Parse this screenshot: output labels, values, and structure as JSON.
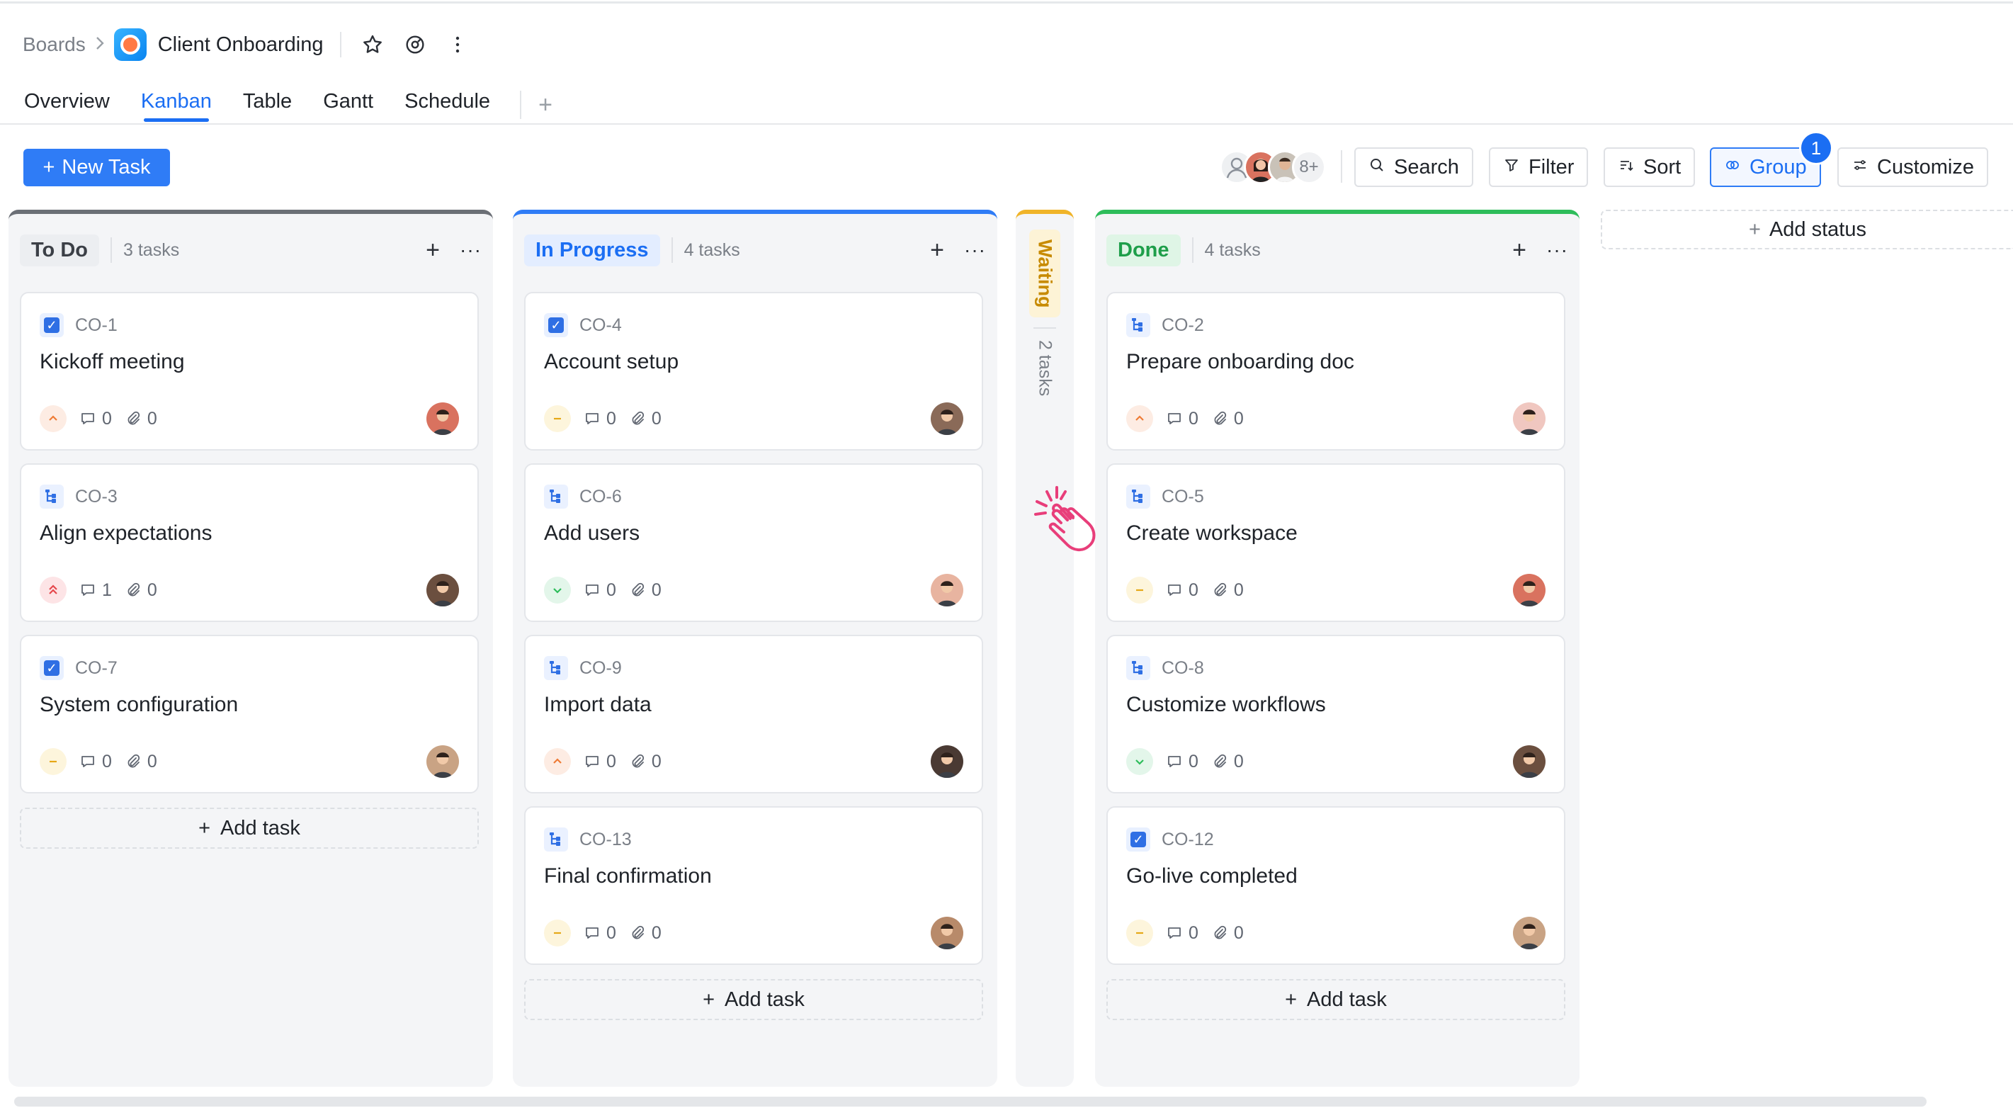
{
  "breadcrumb": {
    "root": "Boards",
    "board": "Client Onboarding"
  },
  "tabs": [
    "Overview",
    "Kanban",
    "Table",
    "Gantt",
    "Schedule"
  ],
  "active_tab": "Kanban",
  "toolbar": {
    "new_task": "New Task",
    "more_members": "8+",
    "search": "Search",
    "filter": "Filter",
    "sort": "Sort",
    "group": "Group",
    "group_badge": "1",
    "customize": "Customize",
    "add_status": "Add status"
  },
  "columns": [
    {
      "name": "To Do",
      "count": "3 tasks",
      "color": "#6b6f76",
      "pill_bg": "#eceef1",
      "pill_fg": "#3b3f46",
      "cards": [
        {
          "id": "CO-1",
          "type": "check",
          "title": "Kickoff meeting",
          "priority": "high",
          "comments": "0",
          "attachments": "0"
        },
        {
          "id": "CO-3",
          "type": "subtask",
          "title": "Align expectations",
          "priority": "urgent",
          "comments": "1",
          "attachments": "0"
        },
        {
          "id": "CO-7",
          "type": "check",
          "title": "System configuration",
          "priority": "medium",
          "comments": "0",
          "attachments": "0"
        }
      ],
      "add_label": "Add task"
    },
    {
      "name": "In Progress",
      "count": "4 tasks",
      "color": "#2f7cf6",
      "pill_bg": "#e3edff",
      "pill_fg": "#1b6ef3",
      "cards": [
        {
          "id": "CO-4",
          "type": "check",
          "title": "Account setup",
          "priority": "medium",
          "comments": "0",
          "attachments": "0"
        },
        {
          "id": "CO-6",
          "type": "subtask",
          "title": "Add users",
          "priority": "low",
          "comments": "0",
          "attachments": "0"
        },
        {
          "id": "CO-9",
          "type": "subtask",
          "title": "Import data",
          "priority": "high",
          "comments": "0",
          "attachments": "0"
        },
        {
          "id": "CO-13",
          "type": "subtask",
          "title": "Final confirmation",
          "priority": "medium",
          "comments": "0",
          "attachments": "0"
        }
      ],
      "add_label": "Add task"
    },
    {
      "name": "Done",
      "count": "4 tasks",
      "color": "#2ebd5b",
      "pill_bg": "#dff5e6",
      "pill_fg": "#1e9e4a",
      "cards": [
        {
          "id": "CO-2",
          "type": "subtask",
          "title": "Prepare onboarding doc",
          "priority": "high",
          "comments": "0",
          "attachments": "0"
        },
        {
          "id": "CO-5",
          "type": "subtask",
          "title": "Create workspace",
          "priority": "medium",
          "comments": "0",
          "attachments": "0"
        },
        {
          "id": "CO-8",
          "type": "subtask",
          "title": "Customize workflows",
          "priority": "low",
          "comments": "0",
          "attachments": "0"
        },
        {
          "id": "CO-12",
          "type": "check",
          "title": "Go-live completed",
          "priority": "medium",
          "comments": "0",
          "attachments": "0"
        }
      ],
      "add_label": "Add task"
    }
  ],
  "waiting": {
    "name": "Waiting",
    "count": "2 tasks",
    "color": "#f0b429"
  }
}
